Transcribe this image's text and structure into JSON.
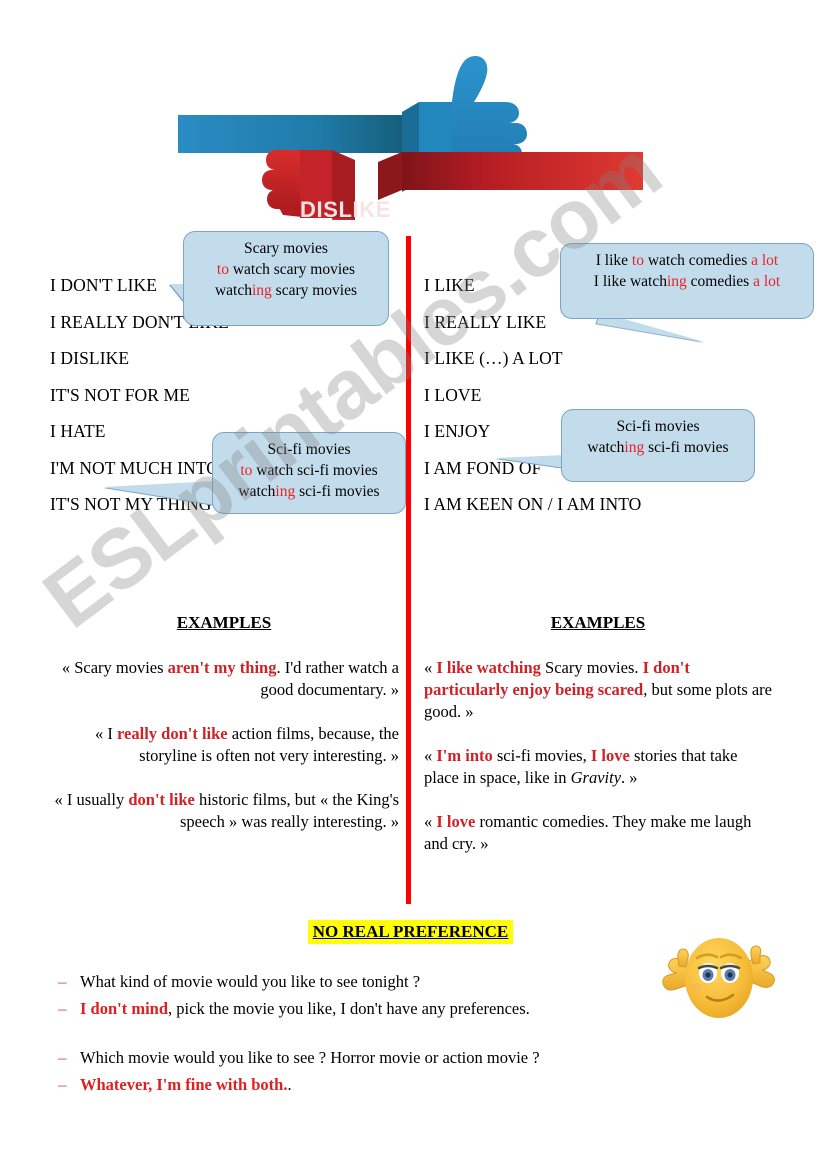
{
  "banner": {
    "like_label": "LIKE",
    "dislike_label": "DISLIKE",
    "blue_color": "#2389c2",
    "red_color": "#c1272d"
  },
  "watermark": {
    "text": "ESLprintables.com"
  },
  "divider": {
    "color": "#ff0000"
  },
  "left_column": {
    "phrases": [
      {
        "text": "I DON'T LIKE"
      },
      {
        "text": "I REALLY DON'T LIKE"
      },
      {
        "text": "I DISLIKE"
      },
      {
        "text": "IT'S NOT FOR ME"
      },
      {
        "text": "I HATE"
      },
      {
        "text": "I'M NOT MUCH INTO"
      },
      {
        "text": "IT'S NOT MY THING"
      }
    ],
    "examples_heading": "EXAMPLES",
    "examples": [
      {
        "parts": [
          {
            "text": "« Scary movies ",
            "style": "plain"
          },
          {
            "text": "aren't my thing",
            "style": "red"
          },
          {
            "text": ". I'd rather watch a good documentary. »",
            "style": "plain"
          }
        ]
      },
      {
        "parts": [
          {
            "text": "« I ",
            "style": "plain"
          },
          {
            "text": "really don't like",
            "style": "red"
          },
          {
            "text": " action films, because, the storyline is often not very interesting. »",
            "style": "plain"
          }
        ]
      },
      {
        "parts": [
          {
            "text": "« I usually ",
            "style": "plain"
          },
          {
            "text": "don't like",
            "style": "red"
          },
          {
            "text": " historic films, but « the King's speech » was really interesting. »",
            "style": "plain"
          }
        ]
      }
    ]
  },
  "right_column": {
    "phrases": [
      {
        "text": "I LIKE"
      },
      {
        "text": "I REALLY LIKE"
      },
      {
        "text": "I LIKE (…) A LOT"
      },
      {
        "text": "I LOVE"
      },
      {
        "text": "I ENJOY"
      },
      {
        "text": "I AM FOND OF"
      },
      {
        "text": "I AM KEEN ON / I AM INTO"
      }
    ],
    "examples_heading": "EXAMPLES",
    "examples": [
      {
        "parts": [
          {
            "text": "« ",
            "style": "plain"
          },
          {
            "text": "I like watching",
            "style": "red"
          },
          {
            "text": " Scary movies. ",
            "style": "plain"
          },
          {
            "text": "I don't particularly enjoy being scared",
            "style": "red"
          },
          {
            "text": ", but some plots are good. »",
            "style": "plain"
          }
        ]
      },
      {
        "parts": [
          {
            "text": "« ",
            "style": "plain"
          },
          {
            "text": "I'm into",
            "style": "red"
          },
          {
            "text": " sci-fi movies, ",
            "style": "plain"
          },
          {
            "text": "I love",
            "style": "red"
          },
          {
            "text": " stories that take place in space, like in ",
            "style": "plain"
          },
          {
            "text": "Gravity",
            "style": "italic"
          },
          {
            "text": ". »",
            "style": "plain"
          }
        ]
      },
      {
        "parts": [
          {
            "text": "« ",
            "style": "plain"
          },
          {
            "text": "I love",
            "style": "red"
          },
          {
            "text": " romantic comedies. They make me laugh and cry. »",
            "style": "plain"
          }
        ]
      }
    ]
  },
  "bubbles": [
    {
      "id": "bubble1",
      "lines": [
        [
          {
            "text": "Scary movies",
            "style": "plain"
          }
        ],
        [
          {
            "text": "to",
            "style": "red"
          },
          {
            "text": " watch scary movies",
            "style": "plain"
          }
        ],
        [
          {
            "text": "watch",
            "style": "plain"
          },
          {
            "text": "ing",
            "style": "red"
          },
          {
            "text": " scary movies",
            "style": "plain"
          }
        ]
      ]
    },
    {
      "id": "bubble2",
      "lines": [
        [
          {
            "text": "Sci-fi movies",
            "style": "plain"
          }
        ],
        [
          {
            "text": "to",
            "style": "red"
          },
          {
            "text": " watch sci-fi movies",
            "style": "plain"
          }
        ],
        [
          {
            "text": "watch",
            "style": "plain"
          },
          {
            "text": "ing",
            "style": "red"
          },
          {
            "text": " sci-fi movies",
            "style": "plain"
          }
        ]
      ]
    },
    {
      "id": "bubble3",
      "lines": [
        [
          {
            "text": "I like ",
            "style": "plain"
          },
          {
            "text": "to",
            "style": "red"
          },
          {
            "text": " watch comedies ",
            "style": "plain"
          },
          {
            "text": "a lot",
            "style": "red"
          }
        ],
        [
          {
            "text": "I like watch",
            "style": "plain"
          },
          {
            "text": "ing",
            "style": "red"
          },
          {
            "text": " comedies ",
            "style": "plain"
          },
          {
            "text": "a lot",
            "style": "red"
          }
        ]
      ]
    },
    {
      "id": "bubble4",
      "lines": [
        [
          {
            "text": "Sci-fi movies",
            "style": "plain"
          }
        ],
        [
          {
            "text": "watch",
            "style": "plain"
          },
          {
            "text": "ing",
            "style": "red"
          },
          {
            "text": " sci-fi movies",
            "style": "plain"
          }
        ]
      ]
    }
  ],
  "no_preference": {
    "heading": "NO REAL PREFERENCE",
    "highlight_color": "#ffff00",
    "dash": "–",
    "dialogues": [
      {
        "lines": [
          {
            "parts": [
              {
                "text": "What kind of movie would you like to see tonight ?",
                "style": "plain"
              }
            ]
          },
          {
            "parts": [
              {
                "text": "I don't mind",
                "style": "red"
              },
              {
                "text": ", pick the movie you like, I don't have any preferences.",
                "style": "plain"
              }
            ]
          }
        ]
      },
      {
        "lines": [
          {
            "parts": [
              {
                "text": "Which movie would you like to see ? Horror movie or action movie ?",
                "style": "plain"
              }
            ]
          },
          {
            "parts": [
              {
                "text": "Whatever, I'm fine with both.",
                "style": "red"
              },
              {
                "text": ".",
                "style": "plain"
              }
            ]
          }
        ]
      }
    ]
  },
  "emoji": {
    "name": "shrugging-face-emoji"
  }
}
